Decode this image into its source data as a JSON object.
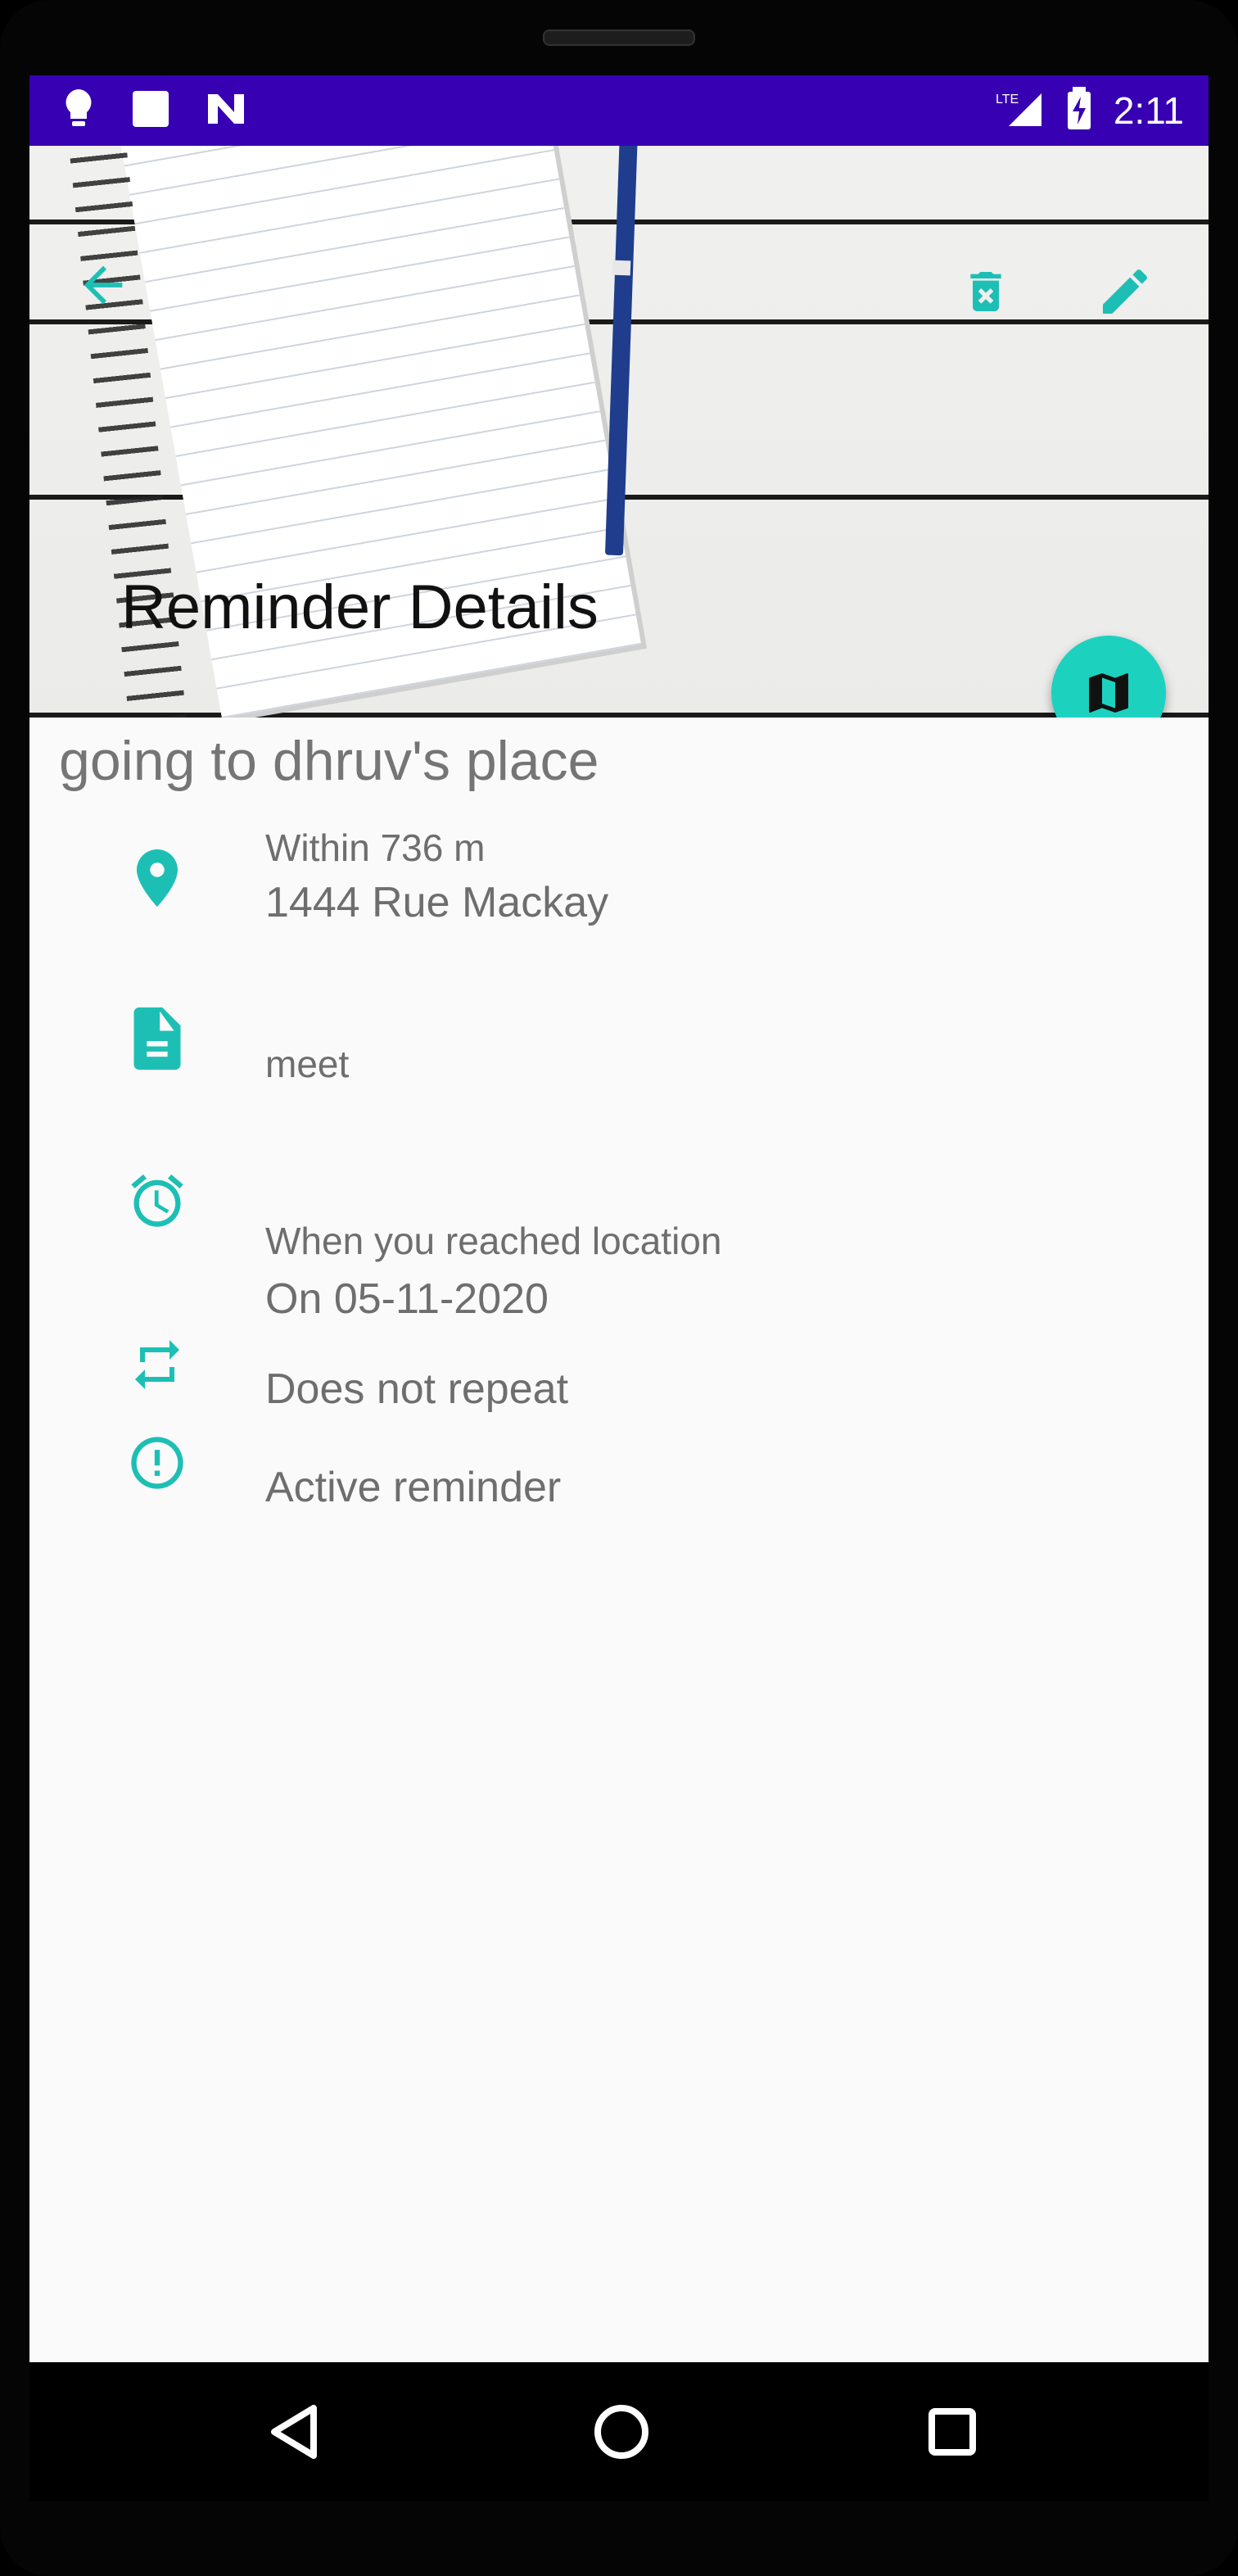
{
  "status_bar": {
    "time": "2:11",
    "network": "LTE",
    "left_icons": [
      "lightbulb-icon",
      "square-icon",
      "n-logo-icon"
    ],
    "background": "#3700b3"
  },
  "header": {
    "title": "Reminder Details"
  },
  "reminder": {
    "title": "going to dhruv's place",
    "location": {
      "radius": "Within 736 m",
      "address": "1444 Rue Mackay"
    },
    "note": "meet",
    "trigger": {
      "condition": "When you reached location",
      "date": "On 05-11-2020"
    },
    "repeat": "Does not repeat",
    "status": "Active reminder"
  },
  "colors": {
    "accent": "#1dbfb5",
    "fab": "#1dd1bf",
    "text_secondary": "#6e6e6e"
  }
}
